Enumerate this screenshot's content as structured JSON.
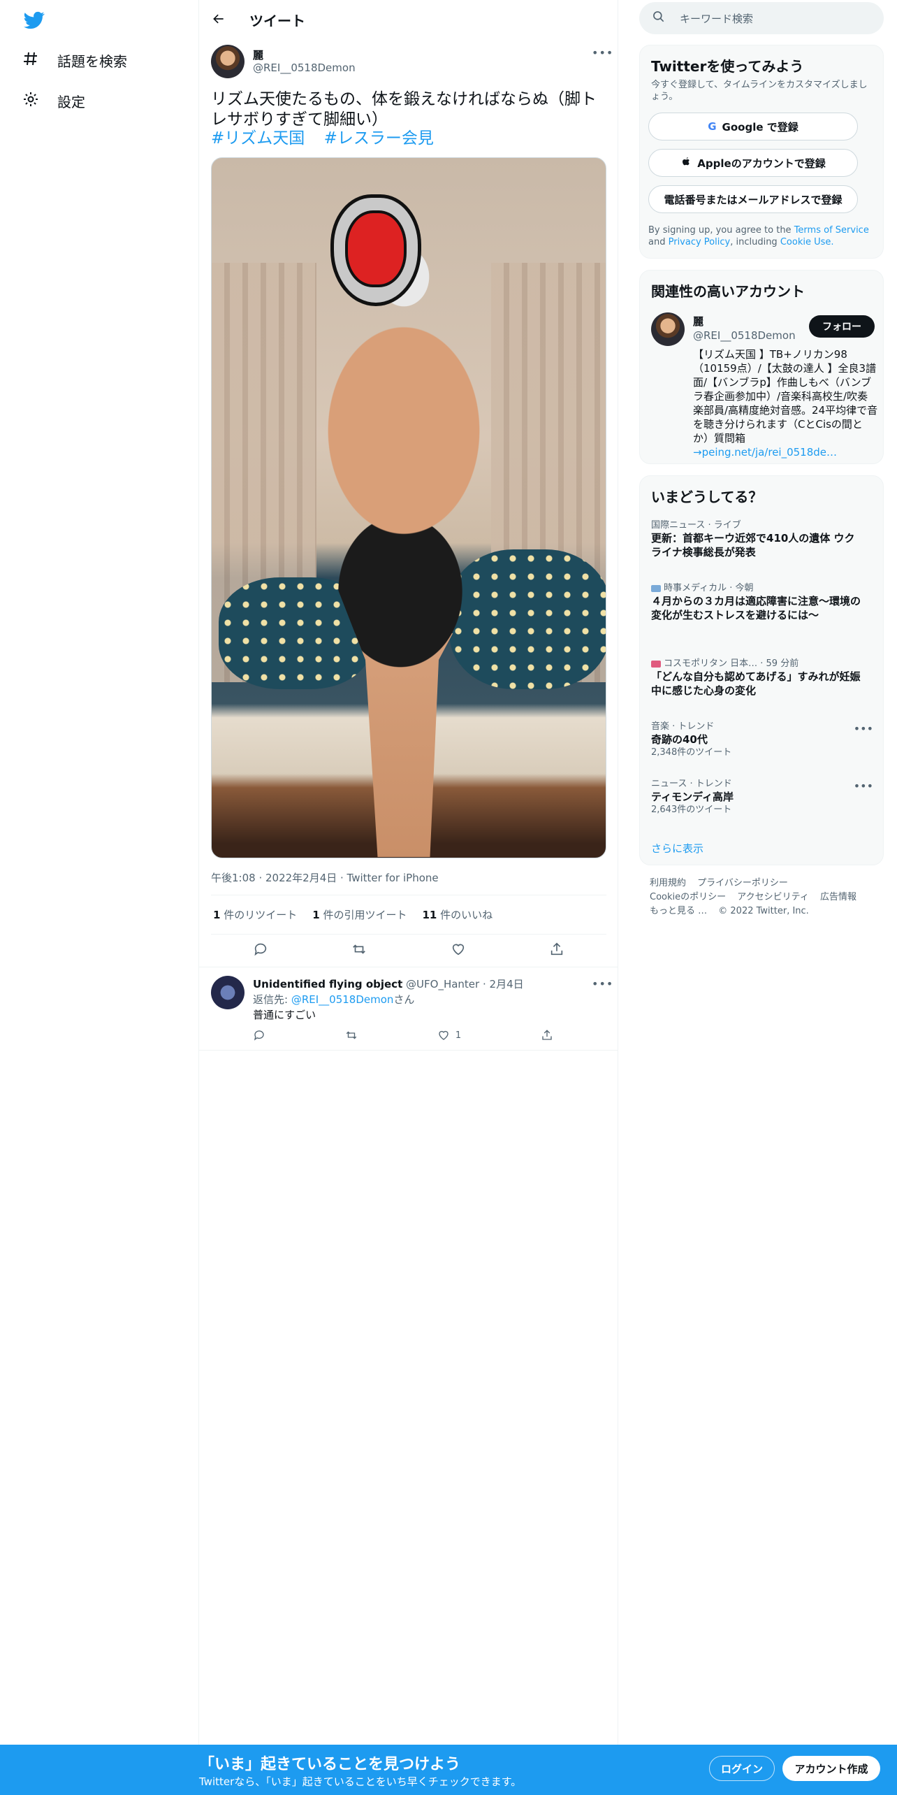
{
  "nav": {
    "explore_label": "話題を検索",
    "settings_label": "設定"
  },
  "header": {
    "title": "ツイート"
  },
  "tweet": {
    "author_name": "麗",
    "author_handle": "@REI__0518Demon",
    "text": "リズム天使たるもの、体を鍛えなければならぬ（脚トレサボりすぎて脚細い）",
    "hashtags": [
      "#リズム天国",
      "#レスラー会見"
    ],
    "meta": "午後1:08 · 2022年2月4日 · Twitter for iPhone",
    "retweets_count": "1",
    "retweets_label": "件のリツイート",
    "quotes_count": "1",
    "quotes_label": "件の引用ツイート",
    "likes_count": "11",
    "likes_label": "件のいいね"
  },
  "reply": {
    "name": "Unidentified flying object",
    "handle": "@UFO_Hanter",
    "date": "· 2月4日",
    "replying_prefix": "返信先:",
    "replying_handle": "@REI__0518Demon",
    "replying_suffix": "さん",
    "text": "普通にすごい",
    "like_count": "1"
  },
  "search": {
    "placeholder": "キーワード検索"
  },
  "signup_card": {
    "title": "Twitterを使ってみよう",
    "subtitle": "今すぐ登録して、タイムラインをカスタマイズしましょう。",
    "google_label": "Google で登録",
    "apple_label": "Appleのアカウントで登録",
    "email_label": "電話番号またはメールアドレスで登録",
    "legal_prefix": "By signing up, you agree to the",
    "terms": "Terms of Service",
    "and": "and",
    "privacy": "Privacy Policy",
    "including": ", including",
    "cookie": "Cookie Use."
  },
  "related": {
    "title": "関連性の高いアカウント",
    "name": "麗",
    "handle": "@REI__0518Demon",
    "follow_label": "フォロー",
    "bio": "【リズム天国 】TB+ノリカン98（10159点）/【太鼓の達人 】全良3譜面/【バンブラp】作曲しもべ（バンブラ春企画参加中）/音楽科高校生/吹奏楽部員/高精度絶対音感。24平均律で音を聴き分けられます（CとCisの間とか）質問箱",
    "bio_link": "→peing.net/ja/rei_0518de…"
  },
  "trends": {
    "title": "いまどうしてる？",
    "items": [
      {
        "category": "国際ニュース · ライブ",
        "title": "更新：首都キーウ近郊で410人の遺体 ウクライナ検事総長が発表"
      },
      {
        "category": "時事メディカル · 今朝",
        "title": "４月からの３カ月は適応障害に注意～環境の変化が生むストレスを避けるには～"
      },
      {
        "category": "コスモポリタン 日本… · 59 分前",
        "title": "「どんな自分も認めてあげる」すみれが妊娠中に感じた心身の変化"
      },
      {
        "category": "音楽 · トレンド",
        "title": "奇跡の40代",
        "count": "2,348件のツイート"
      },
      {
        "category": "ニュース · トレンド",
        "title": "ティモンディ高岸",
        "count": "2,643件のツイート"
      }
    ],
    "show_more": "さらに表示"
  },
  "footer": {
    "links": [
      "利用規約",
      "プライバシーポリシー",
      "Cookieのポリシー",
      "アクセシビリティ",
      "広告情報",
      "もっと見る …",
      "© 2022 Twitter, Inc."
    ]
  },
  "bottom_bar": {
    "title": "「いま」起きていることを見つけよう",
    "subtitle": "Twitterなら、「いま」起きていることをいち早くチェックできます。",
    "login_label": "ログイン",
    "signup_label": "アカウント作成"
  },
  "colors": {
    "accent": "#1d9bf0",
    "text": "#0f1419",
    "secondary": "#536471"
  }
}
